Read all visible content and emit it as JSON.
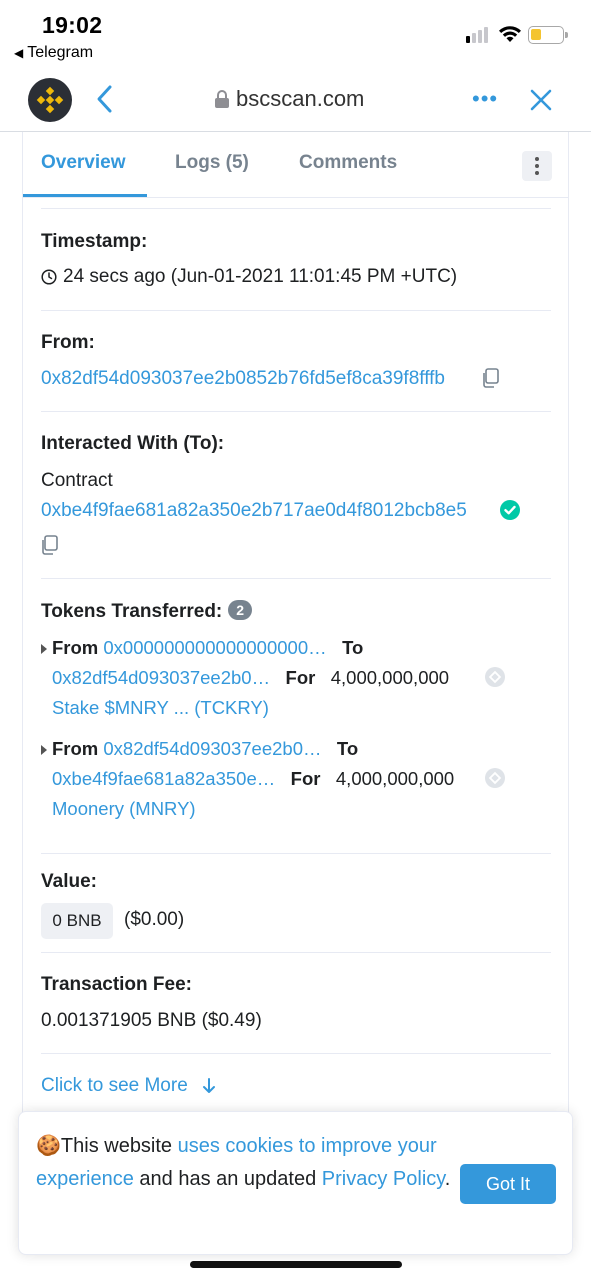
{
  "status_bar": {
    "time": "19:02",
    "back_app": "Telegram"
  },
  "browser": {
    "url": "bscscan.com",
    "more": "•••"
  },
  "tabs": [
    {
      "label": "Overview",
      "active": true
    },
    {
      "label": "Logs (5)",
      "active": false
    },
    {
      "label": "Comments",
      "active": false
    }
  ],
  "timestamp": {
    "label": "Timestamp:",
    "value": "24 secs ago (Jun-01-2021 11:01:45 PM +UTC)"
  },
  "from": {
    "label": "From:",
    "address": "0x82df54d093037ee2b0852b76fd5ef8ca39f8fffb"
  },
  "to": {
    "label": "Interacted With (To):",
    "prefix": "Contract",
    "address": "0xbe4f9fae681a82a350e2b717ae0d4f8012bcb8e5"
  },
  "tokens": {
    "label": "Tokens Transferred:",
    "count": "2",
    "from_word": "From",
    "to_word": "To",
    "for_word": "For",
    "transfers": [
      {
        "from": "0x000000000000000000…",
        "to": "0x82df54d093037ee2b0…",
        "amount": "4,000,000,000",
        "token": "Stake $MNRY ... (TCKRY)"
      },
      {
        "from": "0x82df54d093037ee2b0…",
        "to": "0xbe4f9fae681a82a350e…",
        "amount": "4,000,000,000",
        "token": "Moonery (MNRY)"
      }
    ]
  },
  "value": {
    "label": "Value:",
    "amount": "0 BNB",
    "usd": "($0.00)"
  },
  "fee": {
    "label": "Transaction Fee:",
    "value": "0.001371905 BNB ($0.49)"
  },
  "more_link": "Click to see More",
  "cookie": {
    "emoji": "🍪",
    "text1": "This website ",
    "link1": "uses cookies to improve your experience",
    "text2": " and has an updated ",
    "link2": "Privacy Policy",
    "text3": ".",
    "button": "Got It"
  },
  "colors": {
    "link": "#3498db",
    "success": "#00c9a7",
    "badge": "#77838f"
  }
}
